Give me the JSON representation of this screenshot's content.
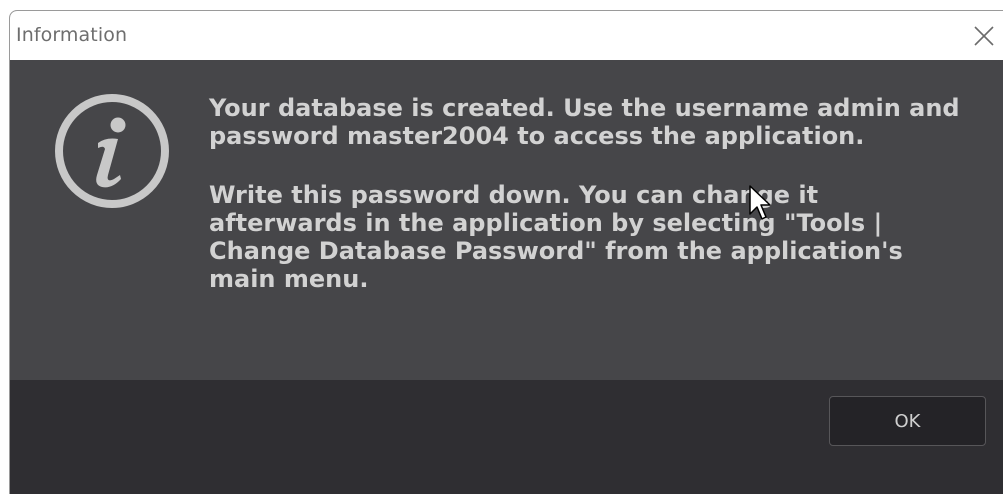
{
  "window": {
    "title": "Information"
  },
  "icons": {
    "close": "close-icon",
    "info": "info-icon",
    "cursor": "mouse-cursor-icon"
  },
  "message": {
    "paragraph1": "Your database is created. Use the username admin and password master2004 to access the application.",
    "paragraph2": "Write this password down. You can change it afterwards in the application by selecting \"Tools | Change Database Password\" from the application's main menu."
  },
  "buttons": {
    "ok_label": "OK"
  },
  "colors": {
    "body_bg": "#464649",
    "footer_bg": "#2f2e32",
    "text": "#d2d2d2",
    "icon": "#c8c8c8"
  }
}
